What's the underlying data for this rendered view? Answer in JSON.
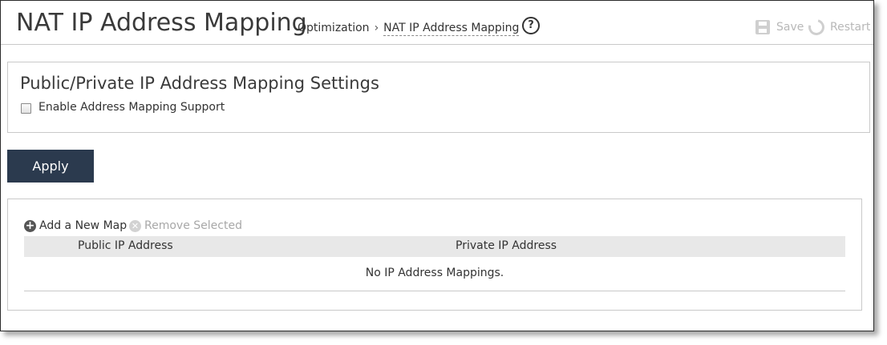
{
  "header": {
    "title": "NAT IP Address Mapping",
    "breadcrumb": {
      "parent": "Optimization",
      "separator": "›",
      "current": "NAT IP Address Mapping"
    },
    "help_icon": "?",
    "save_label": "Save",
    "restart_label": "Restart"
  },
  "settings": {
    "title": "Public/Private IP Address Mapping Settings",
    "enable_label": "Enable Address Mapping Support",
    "enable_checked": false
  },
  "apply_label": "Apply",
  "mappings": {
    "add_label": "Add a New Map",
    "remove_label": "Remove Selected",
    "columns": [
      "Public IP Address",
      "Private IP Address"
    ],
    "empty_message": "No IP Address Mappings."
  },
  "colors": {
    "apply_bg": "#2b3a4e",
    "disabled_text": "#b8b8b8",
    "table_header_bg": "#e8e8e8"
  },
  "icons": {
    "help": "help-circle-icon",
    "save": "save-disk-icon",
    "restart": "restart-icon",
    "add": "plus-circle-icon",
    "remove": "x-circle-icon"
  }
}
